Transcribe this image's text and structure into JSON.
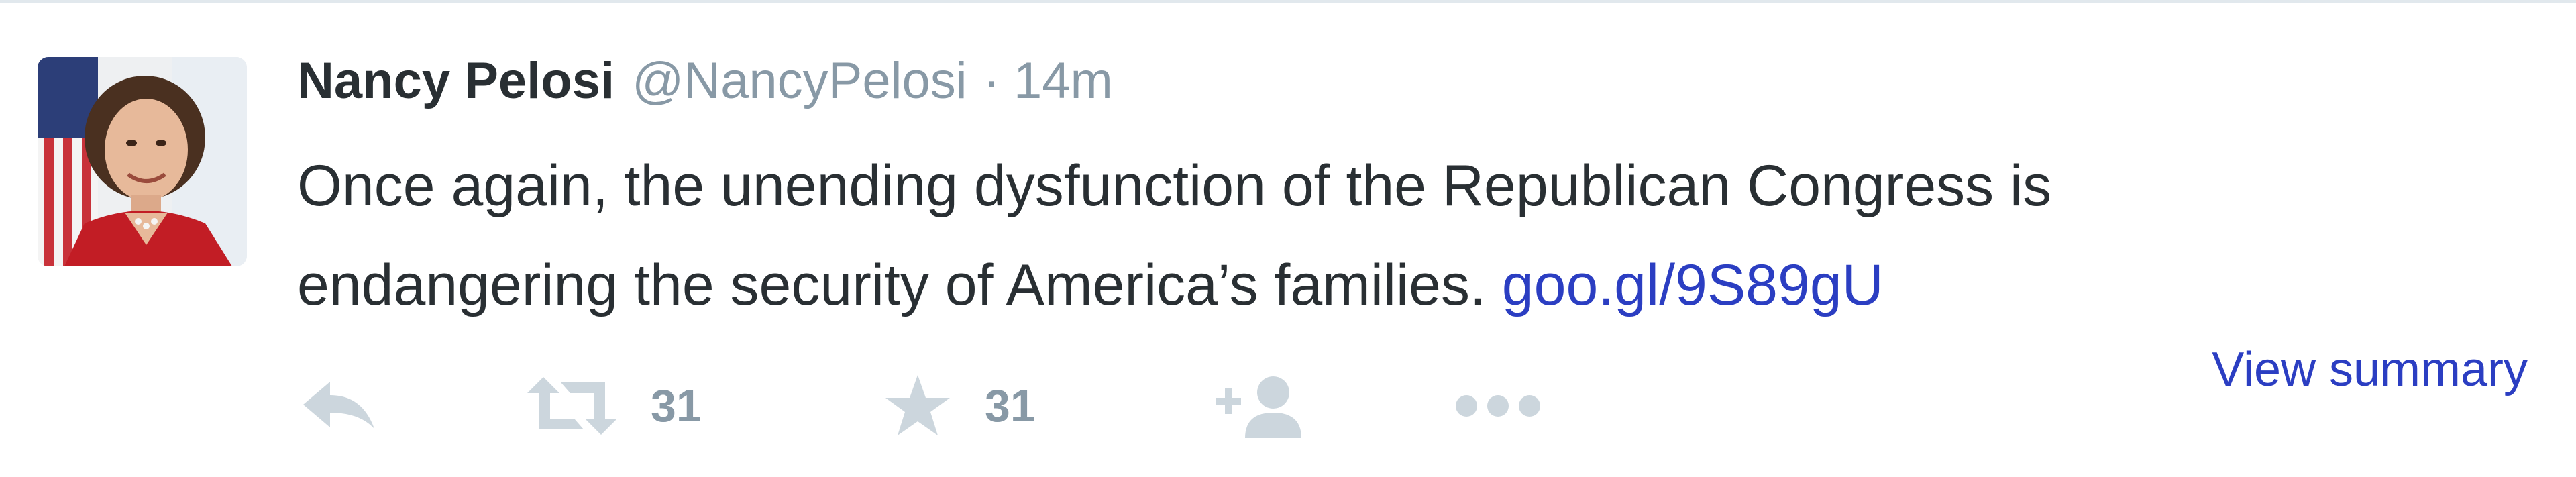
{
  "tweet": {
    "fullname": "Nancy Pelosi",
    "username": "@NancyPelosi",
    "separator": "·",
    "timestamp": "14m",
    "text_line1": "Once again, the unending dysfunction of the Republican Congress is",
    "text_line2": "endangering the security of America’s families.",
    "link": "goo.gl/9S89gU",
    "view_summary": "View summary"
  },
  "actions": {
    "reply": {
      "icon": "reply-icon"
    },
    "retweet": {
      "icon": "retweet-icon",
      "count": "31"
    },
    "favorite": {
      "icon": "star-icon",
      "count": "31"
    },
    "follow": {
      "icon": "follow-icon"
    },
    "more": {
      "icon": "more-icon"
    }
  },
  "colors": {
    "text": "#292f33",
    "muted": "#8899a6",
    "link": "#2b3ec2",
    "action_icon": "#ccd6dd",
    "border": "#e1e8ed"
  }
}
